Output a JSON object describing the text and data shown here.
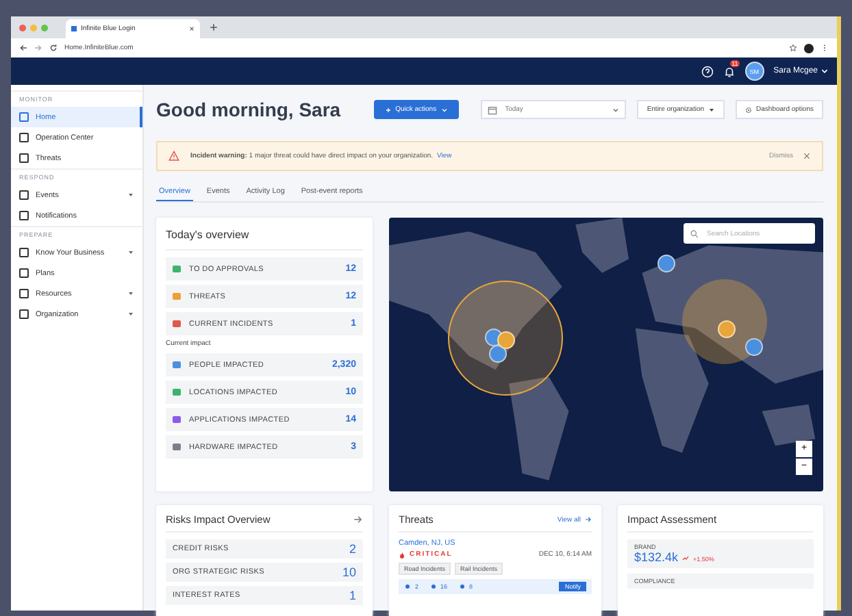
{
  "browser": {
    "tab_title": "Infinite Blue Login",
    "url": "Home.InfiniteBlue.com"
  },
  "header": {
    "notification_count": "11",
    "avatar_initials": "SM",
    "user_name": "Sara Mcgee"
  },
  "sidebar": {
    "sections": [
      {
        "title": "MONITOR",
        "items": [
          {
            "label": "Home",
            "selected": true,
            "expandable": false
          },
          {
            "label": "Operation Center",
            "selected": false,
            "expandable": false
          },
          {
            "label": "Threats",
            "selected": false,
            "expandable": false
          }
        ]
      },
      {
        "title": "RESPOND",
        "items": [
          {
            "label": "Events",
            "selected": false,
            "expandable": true
          },
          {
            "label": "Notifications",
            "selected": false,
            "expandable": false
          }
        ]
      },
      {
        "title": "PREPARE",
        "items": [
          {
            "label": "Know Your Business",
            "selected": false,
            "expandable": true
          },
          {
            "label": "Plans",
            "selected": false,
            "expandable": false
          },
          {
            "label": "Resources",
            "selected": false,
            "expandable": true
          },
          {
            "label": "Organization",
            "selected": false,
            "expandable": true
          }
        ]
      }
    ]
  },
  "greeting": "Good morning, Sara",
  "quick_actions": "Quick actions",
  "date_filter": "Today",
  "org_filter": "Entire organization",
  "dashboard_options": "Dashboard options",
  "banner": {
    "label": "Incident warning:",
    "message": "1 major threat could have direct impact on your organization.",
    "link": "View",
    "dismiss": "Dismiss"
  },
  "tabs": [
    {
      "label": "Overview",
      "selected": true
    },
    {
      "label": "Events",
      "selected": false
    },
    {
      "label": "Activity Log",
      "selected": false
    },
    {
      "label": "Post-event reports",
      "selected": false
    }
  ],
  "overview": {
    "title": "Today's overview",
    "rows": [
      {
        "label": "TO DO APPROVALS",
        "value": "12",
        "color": "#3bb56a"
      },
      {
        "label": "THREATS",
        "value": "12",
        "color": "#f0a030"
      },
      {
        "label": "CURRENT INCIDENTS",
        "value": "1",
        "color": "#e0584a"
      }
    ],
    "impact_title": "Current impact",
    "impact_rows": [
      {
        "label": "PEOPLE IMPACTED",
        "value": "2,320",
        "color": "#4a8fe0"
      },
      {
        "label": "LOCATIONS IMPACTED",
        "value": "10",
        "color": "#3bb56a"
      },
      {
        "label": "APPLICATIONS IMPACTED",
        "value": "14",
        "color": "#8a5ce6"
      },
      {
        "label": "HARDWARE IMPACTED",
        "value": "3",
        "color": "#7a7f8a"
      }
    ]
  },
  "map": {
    "search_placeholder": "Search Locations",
    "zoom_in": "+",
    "zoom_out": "−"
  },
  "risks": {
    "title": "Risks Impact Overview",
    "rows": [
      {
        "label": "CREDIT RISKS",
        "value": "2"
      },
      {
        "label": "ORG STRATEGIC RISKS",
        "value": "10"
      },
      {
        "label": "INTEREST RATES",
        "value": "1"
      }
    ]
  },
  "threats": {
    "title": "Threats",
    "view_all": "View all",
    "location": "Camden, NJ, US",
    "severity": "CRITICAL",
    "time": "DEC 10, 6:14 AM",
    "tags": [
      "Road Incidents",
      "Rail Incidents"
    ],
    "stats": [
      "2",
      "16",
      "8"
    ],
    "notify": "Notify"
  },
  "impact": {
    "title": "Impact Assessment",
    "items": [
      {
        "label": "BRAND",
        "value": "$132.4k",
        "trend": "+1.50%"
      },
      {
        "label": "COMPLIANCE"
      }
    ]
  }
}
